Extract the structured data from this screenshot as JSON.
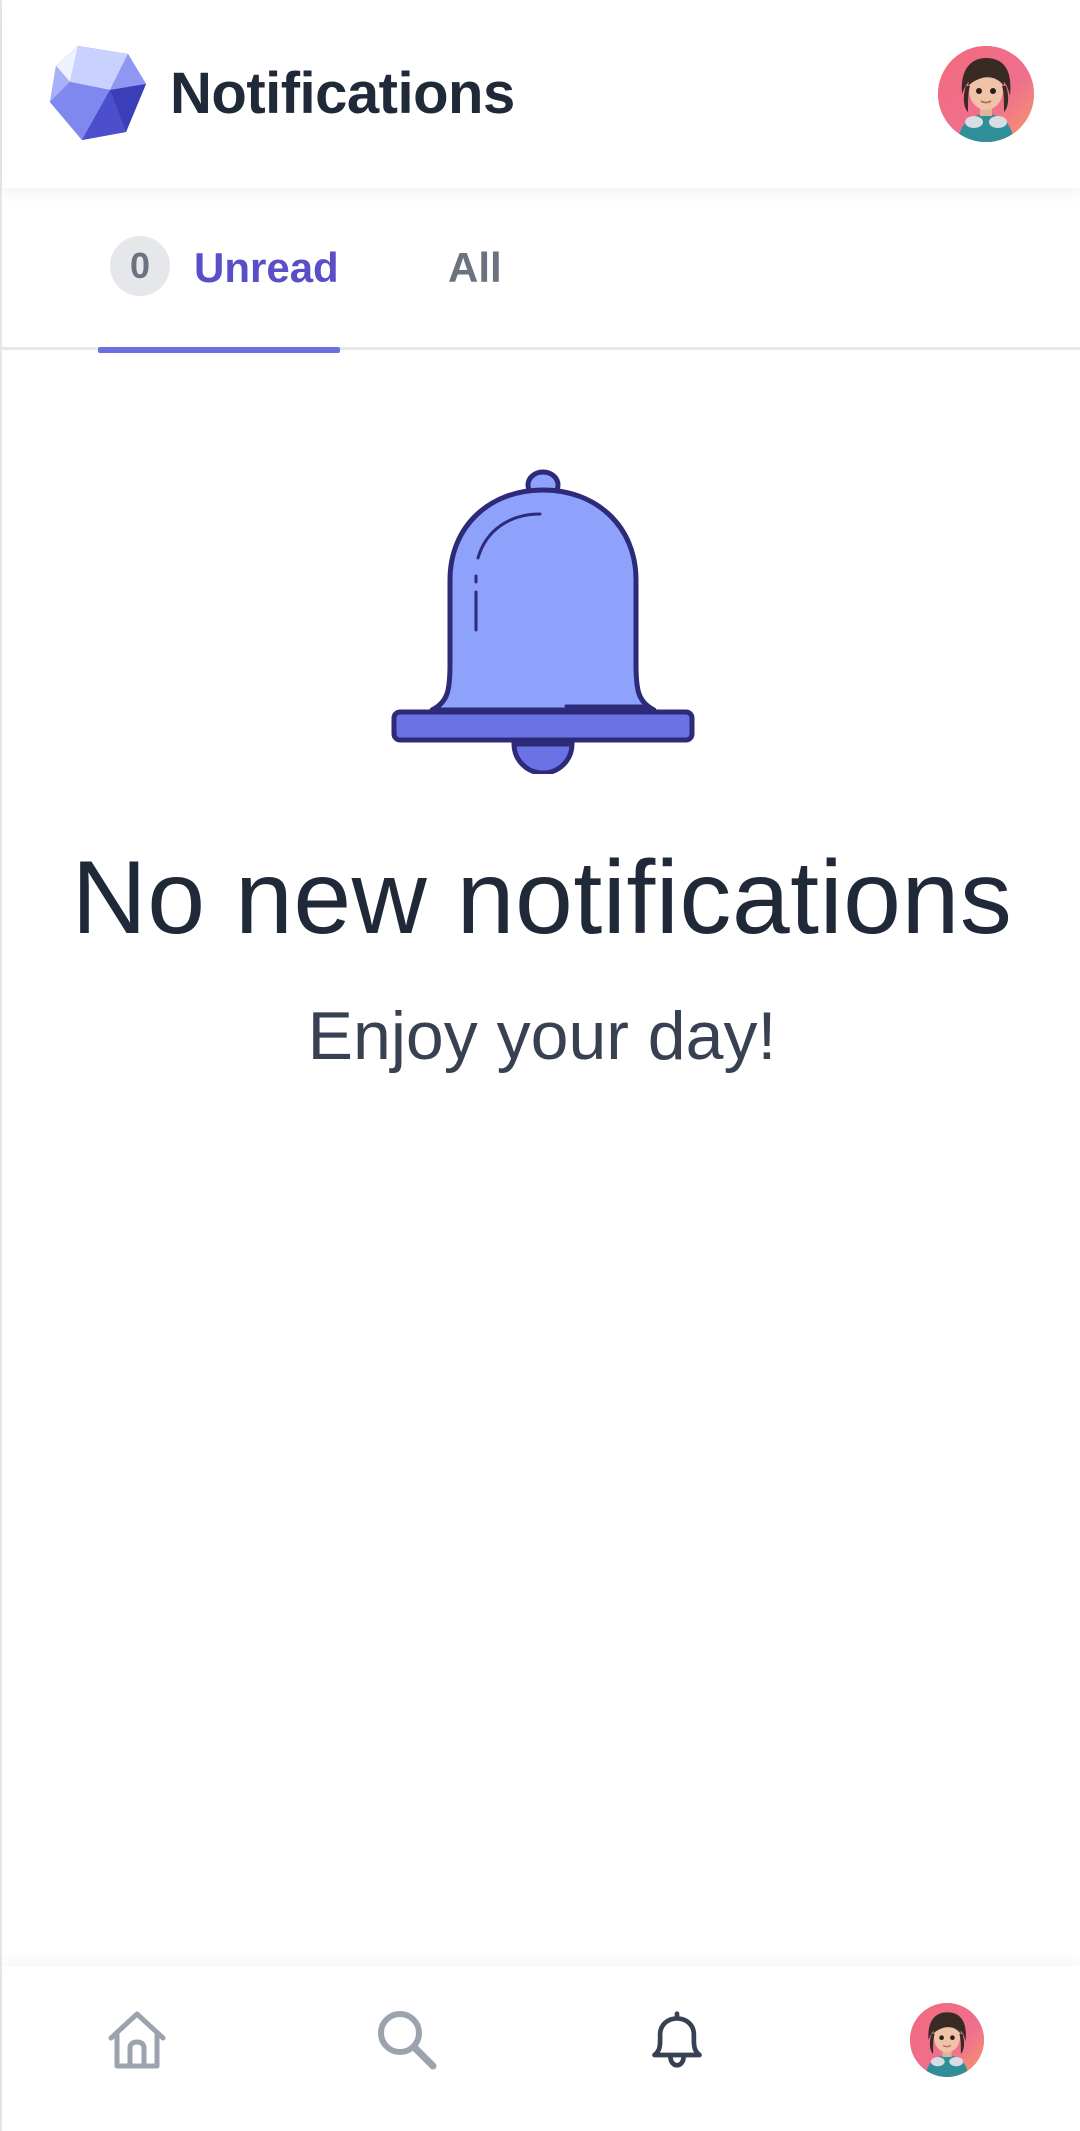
{
  "header": {
    "title": "Notifications",
    "logo_icon": "gem-logo-icon",
    "avatar_icon": "user-avatar"
  },
  "tabs": {
    "unread": {
      "label": "Unread",
      "count": "0"
    },
    "all": {
      "label": "All"
    },
    "active": "unread"
  },
  "empty_state": {
    "icon": "bell-icon",
    "title": "No new notifications",
    "subtitle": "Enjoy your day!"
  },
  "bottom_nav": {
    "items": [
      {
        "icon": "home-icon"
      },
      {
        "icon": "search-icon"
      },
      {
        "icon": "bell-icon"
      },
      {
        "icon": "user-avatar"
      }
    ]
  },
  "colors": {
    "accent": "#5b4fc8",
    "indicator": "#6b6fe0",
    "bell_fill": "#8fa2fb",
    "bell_outline": "#2e2a7a",
    "text_primary": "#1f2937",
    "text_muted": "#6b7280"
  }
}
